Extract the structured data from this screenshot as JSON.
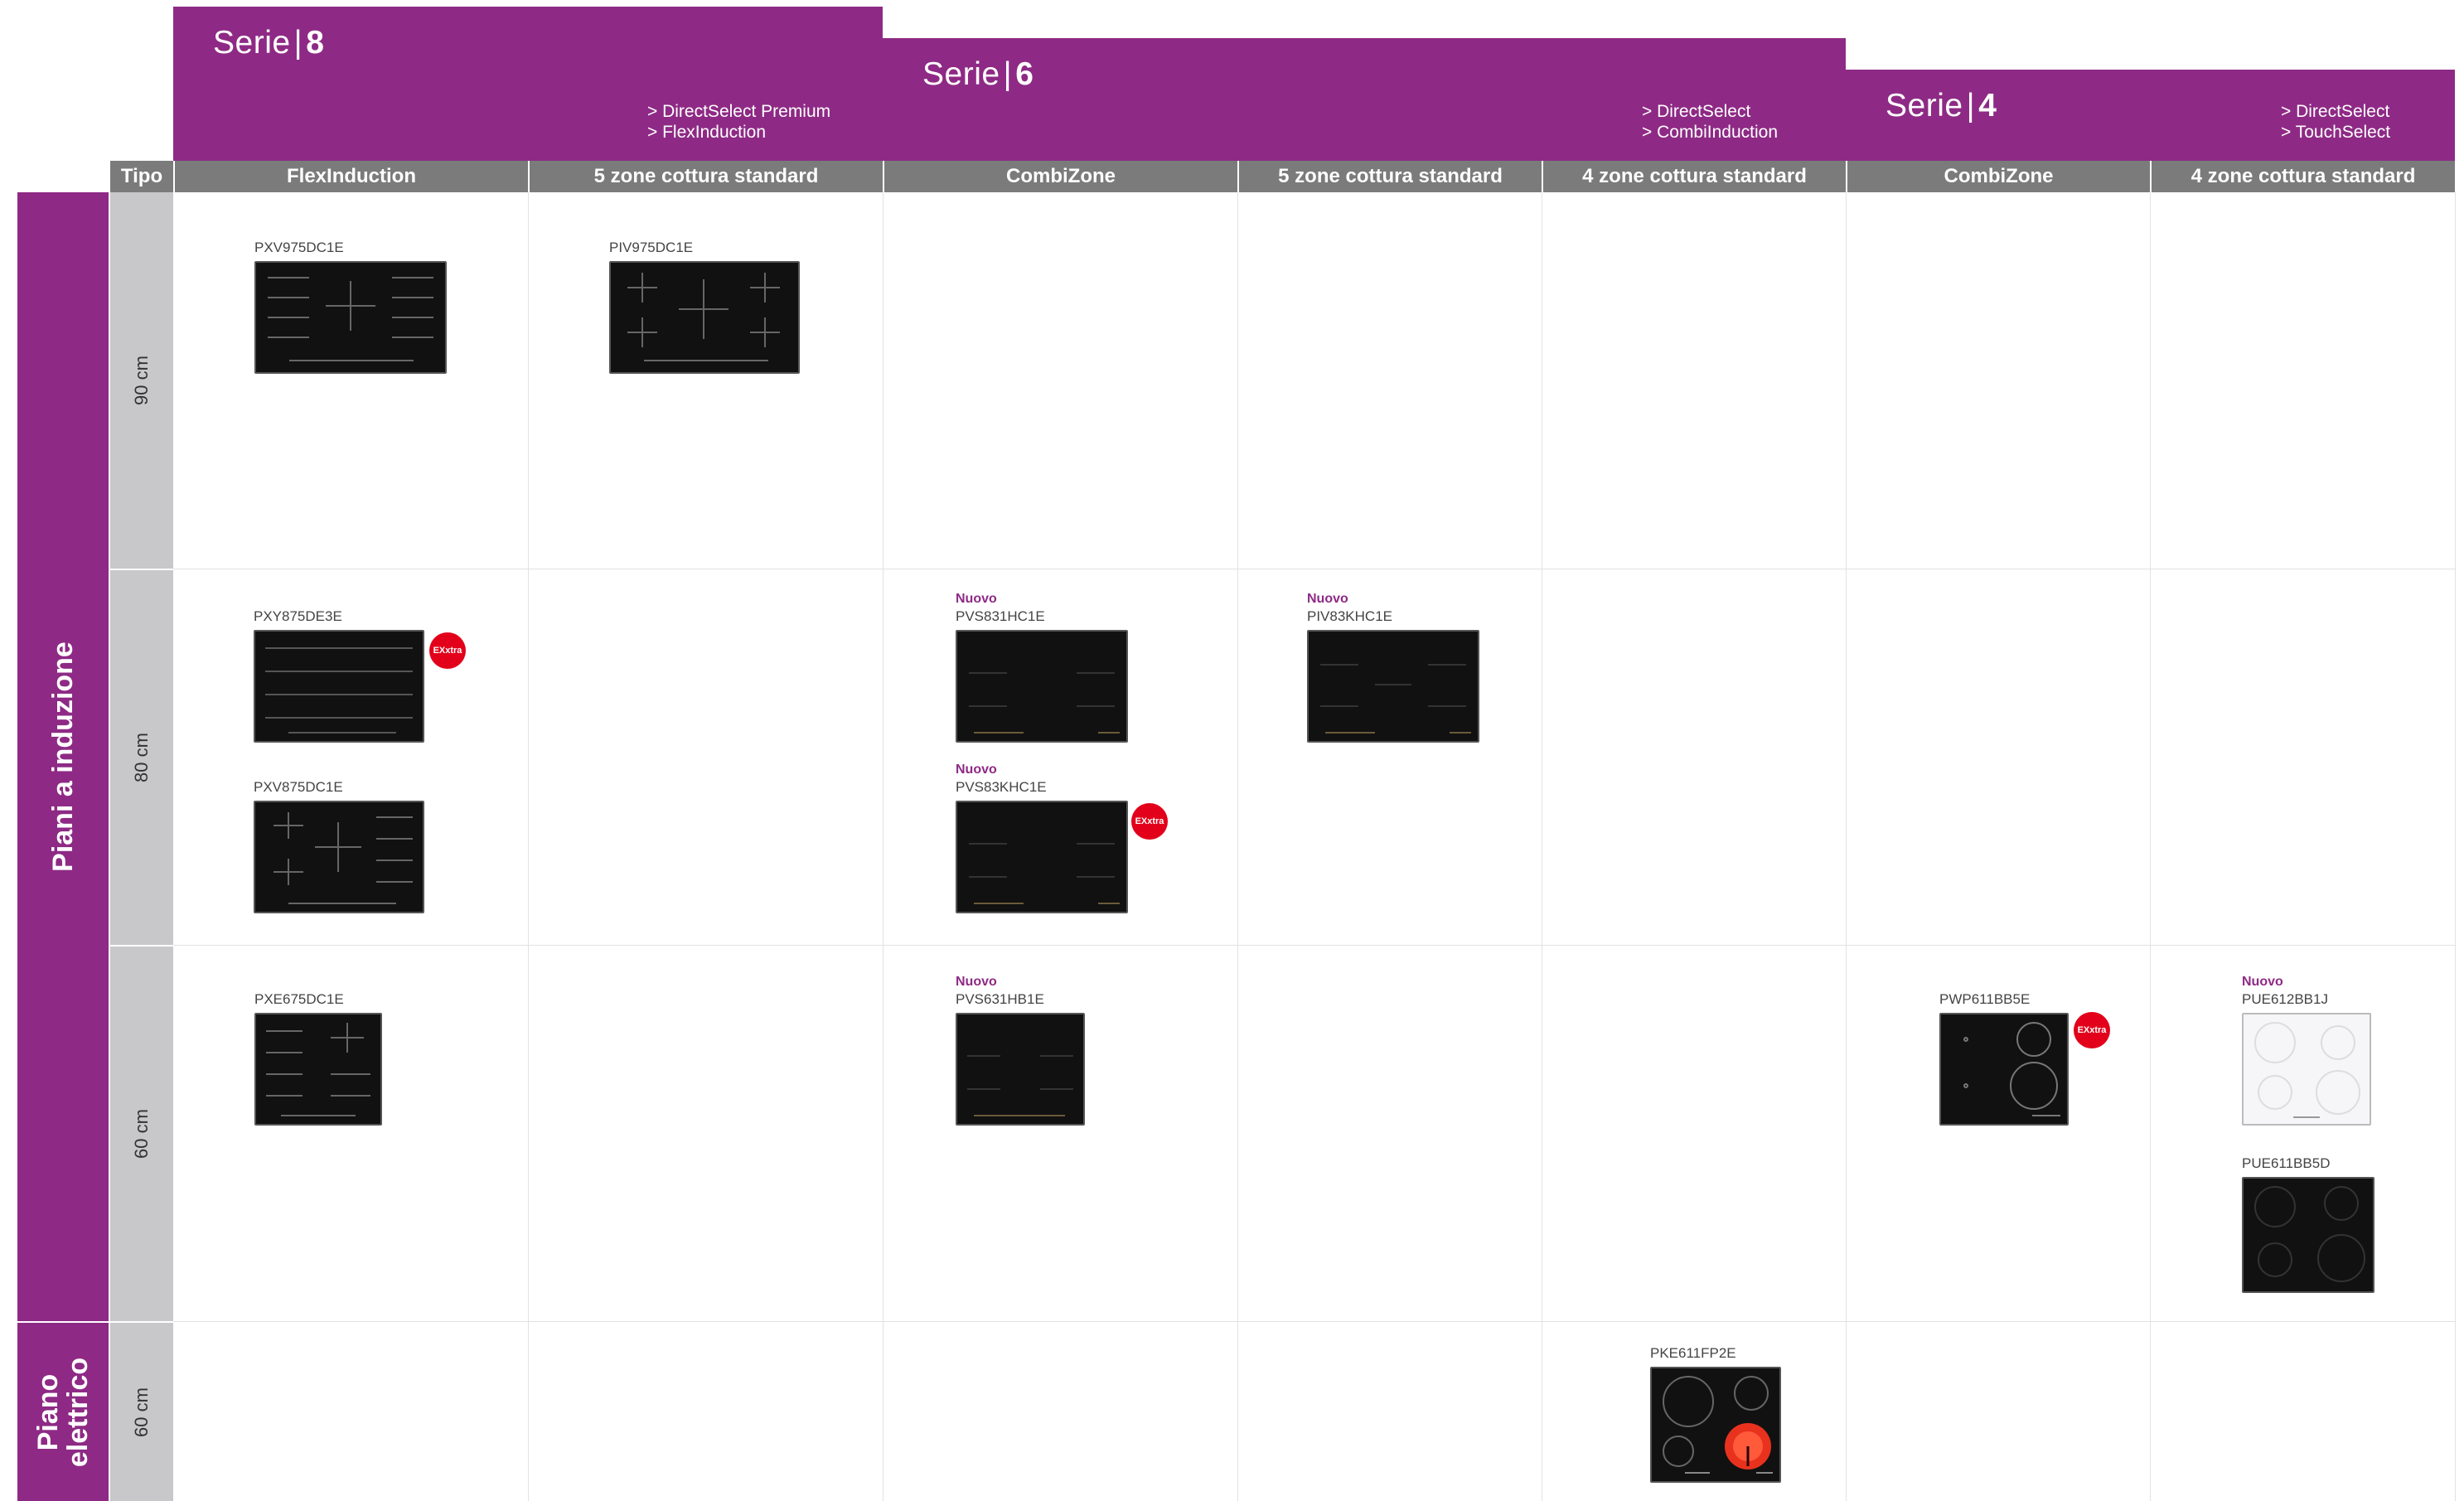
{
  "series": [
    {
      "label": "Serie",
      "number": "8",
      "features": [
        "> DirectSelect Premium",
        "> FlexInduction"
      ]
    },
    {
      "label": "Serie",
      "number": "6",
      "features": [
        "> DirectSelect",
        "> CombiInduction"
      ]
    },
    {
      "label": "Serie",
      "number": "4",
      "features": [
        "> DirectSelect",
        "> TouchSelect"
      ]
    }
  ],
  "tipo_label": "Tipo",
  "columns": [
    "FlexInduction",
    "5 zone cottura standard",
    "CombiZone",
    "5 zone cottura standard",
    "4 zone cottura standard",
    "CombiZone",
    "4 zone cottura standard"
  ],
  "categories": [
    {
      "label": "Piani a induzione"
    },
    {
      "label_line1": "Piano",
      "label_line2": "elettrico"
    }
  ],
  "rows": [
    "90 cm",
    "80 cm",
    "60 cm",
    "60 cm"
  ],
  "badges": {
    "new": "Nuovo",
    "exxtra": "EXxtra"
  },
  "products": [
    {
      "code": "PXV975DC1E",
      "new": false,
      "exxtra": false,
      "color": "black"
    },
    {
      "code": "PIV975DC1E",
      "new": false,
      "exxtra": false,
      "color": "black"
    },
    {
      "code": "PXY875DE3E",
      "new": false,
      "exxtra": true,
      "color": "black"
    },
    {
      "code": "PXV875DC1E",
      "new": false,
      "exxtra": false,
      "color": "black"
    },
    {
      "code": "PVS831HC1E",
      "new": true,
      "exxtra": false,
      "color": "black"
    },
    {
      "code": "PVS83KHC1E",
      "new": true,
      "exxtra": true,
      "color": "black"
    },
    {
      "code": "PIV83KHC1E",
      "new": true,
      "exxtra": false,
      "color": "black"
    },
    {
      "code": "PXE675DC1E",
      "new": false,
      "exxtra": false,
      "color": "black"
    },
    {
      "code": "PVS631HB1E",
      "new": true,
      "exxtra": false,
      "color": "black"
    },
    {
      "code": "PWP611BB5E",
      "new": false,
      "exxtra": true,
      "color": "black"
    },
    {
      "code": "PUE612BB1J",
      "new": true,
      "exxtra": false,
      "color": "white"
    },
    {
      "code": "PUE611BB5D",
      "new": false,
      "exxtra": false,
      "color": "black"
    },
    {
      "code": "PKE611FP2E",
      "new": false,
      "exxtra": false,
      "color": "black"
    }
  ],
  "colors": {
    "brand": "#8e2a85",
    "header_gray": "#7b7b7b",
    "row_gray": "#c8c8ca",
    "exxtra_red": "#e2001a"
  }
}
